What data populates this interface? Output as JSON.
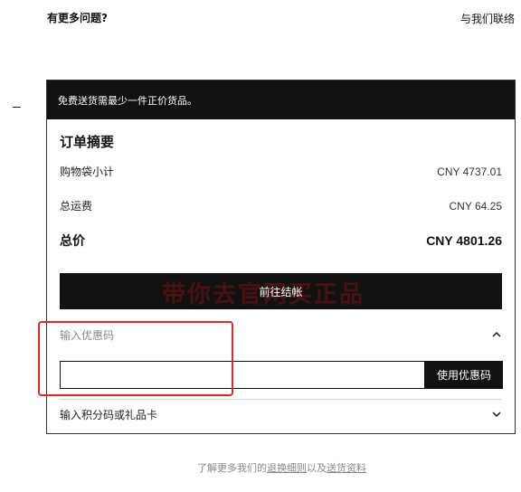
{
  "header": {
    "question": "有更多问题?",
    "contact_link": "与我们联络"
  },
  "banner": {
    "text": "免费送货需最少一件正价货品。"
  },
  "summary": {
    "title": "订单摘要",
    "subtotal_label": "购物袋小计",
    "subtotal_value": "CNY 4737.01",
    "shipping_label": "总运费",
    "shipping_value": "CNY 64.25",
    "total_label": "总价",
    "total_value": "CNY 4801.26"
  },
  "checkout": {
    "button_label": "前往结帐",
    "watermark": "带你去官网买正品"
  },
  "promo": {
    "toggle_label": "输入优惠码",
    "input_value": "",
    "input_placeholder": "",
    "apply_label": "使用优惠码"
  },
  "points": {
    "toggle_label": "输入积分码或礼品卡"
  },
  "footer": {
    "prefix": "了解更多我们的",
    "returns_link": "退换细则",
    "middle": "以及",
    "shipping_link": "送货资料"
  },
  "icons": {
    "promo_chevron": "chevron-up-icon",
    "points_chevron": "chevron-down-icon"
  },
  "colors": {
    "primary": "#111111",
    "highlight": "#e0282d",
    "muted_text": "#888888"
  }
}
